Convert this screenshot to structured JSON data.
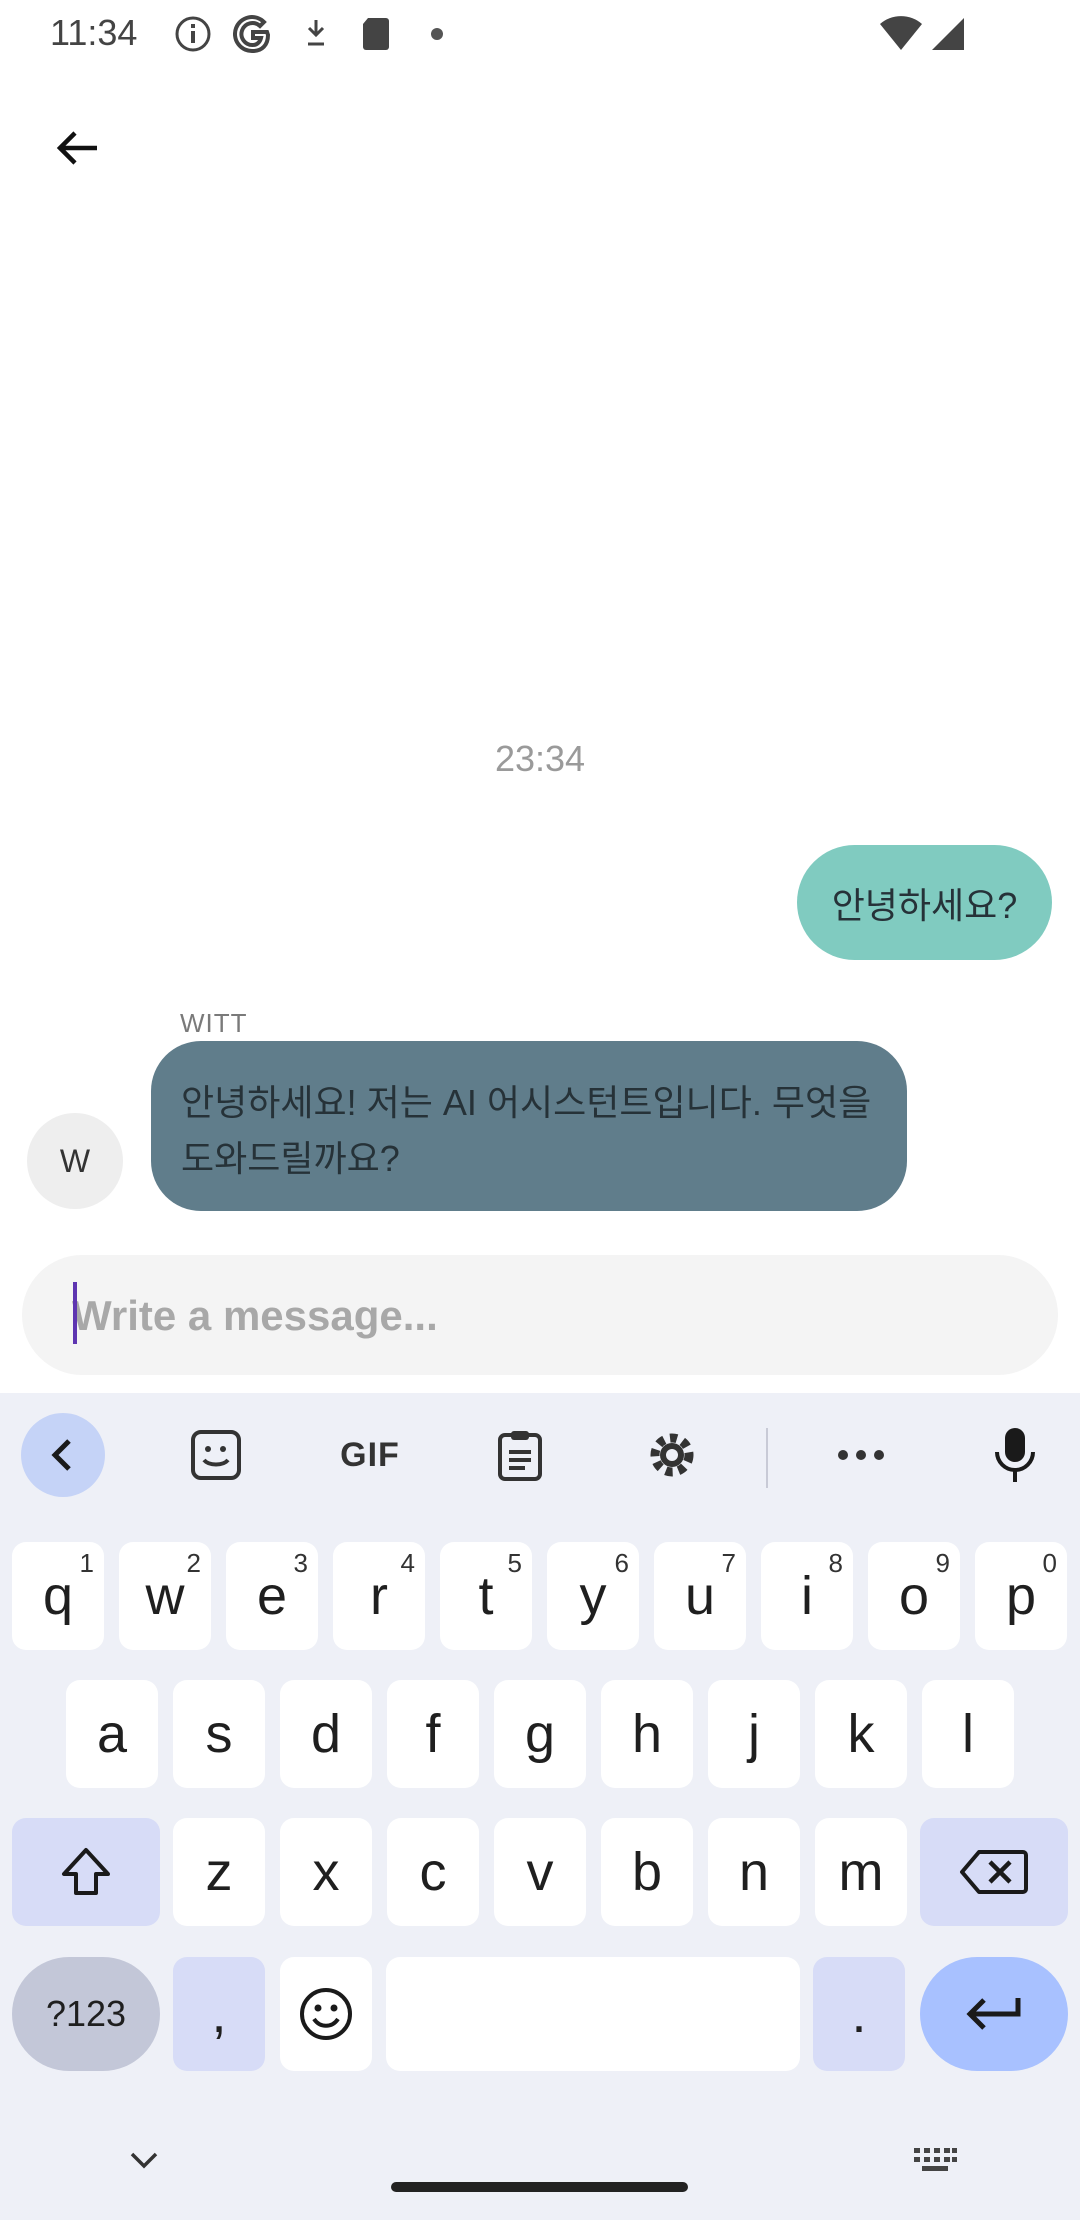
{
  "status_bar": {
    "time": "11:34",
    "icons": [
      "info-icon",
      "google-icon",
      "download-icon",
      "sd-card-icon",
      "dot-icon",
      "wifi-icon",
      "signal-icon"
    ]
  },
  "app_bar": {
    "back_icon": "arrow-back-icon"
  },
  "chat": {
    "timestamp": "23:34",
    "messages": [
      {
        "from": "me",
        "text": "안녕하세요?"
      },
      {
        "from": "WITT",
        "sender_label": "WITT",
        "avatar_letter": "W",
        "text": "안녕하세요! 저는 AI 어시스턴트입니다. 무엇을 도와드릴까요?"
      }
    ],
    "outgoing_color": "#80cbc0",
    "incoming_color": "#607d8b"
  },
  "composer": {
    "placeholder": "Write a message...",
    "value": ""
  },
  "keyboard": {
    "toolbar": [
      "back-icon",
      "sticker-icon",
      "gif-icon",
      "clipboard-icon",
      "settings-icon",
      "more-icon",
      "mic-icon"
    ],
    "gif_label": "GIF",
    "row1": [
      {
        "k": "q",
        "h": "1"
      },
      {
        "k": "w",
        "h": "2"
      },
      {
        "k": "e",
        "h": "3"
      },
      {
        "k": "r",
        "h": "4"
      },
      {
        "k": "t",
        "h": "5"
      },
      {
        "k": "y",
        "h": "6"
      },
      {
        "k": "u",
        "h": "7"
      },
      {
        "k": "i",
        "h": "8"
      },
      {
        "k": "o",
        "h": "9"
      },
      {
        "k": "p",
        "h": "0"
      }
    ],
    "row2": [
      "a",
      "s",
      "d",
      "f",
      "g",
      "h",
      "j",
      "k",
      "l"
    ],
    "row3": [
      "z",
      "x",
      "c",
      "v",
      "b",
      "n",
      "m"
    ],
    "symbols_label": "?123",
    "comma_label": ",",
    "period_label": ".",
    "accent_color": "#a8c1ff"
  }
}
